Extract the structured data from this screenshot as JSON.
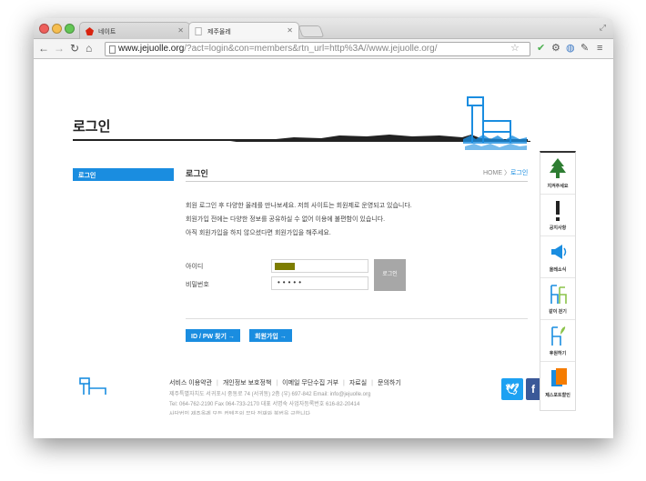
{
  "browser": {
    "tabs": [
      {
        "label": "네이트",
        "active": false
      },
      {
        "label": "제주올레",
        "active": true
      }
    ],
    "url_host": "www.jejuolle.org",
    "url_path": "/?act=login&con=members&rtn_url=http%3A//www.jejuolle.org/",
    "accent": "#1a8de0"
  },
  "page": {
    "heading": "로그인",
    "sidebar": {
      "items": [
        {
          "label": "로그인",
          "active": true
        }
      ]
    },
    "content_title": "로그인",
    "breadcrumb": {
      "home": "HOME",
      "separator": " 〉",
      "current": "로그인"
    },
    "intro": [
      "회원 로그인 후 다양한 올레를 만나보세요. 저희 사이트는 회원제로 운영되고 있습니다.",
      "회원가입 전에는 다양한 정보를 공유하실 수 없어 이용에 불편함이 있습니다.",
      "아직 회원가입을 하지 않으셨다면 회원가입을 해주세요."
    ],
    "form": {
      "id_label": "아이디",
      "pw_label": "비밀번호",
      "pw_value": "•••••",
      "login_button": "로그인"
    },
    "buttons": {
      "find": "ID / PW 찾기 →",
      "join": "회원가입 →"
    }
  },
  "footer": {
    "links": [
      "서비스 이용약관",
      "개인정보 보호정책",
      "이메일 무단수집 거부",
      "자료실",
      "문의하기"
    ],
    "address": "제주특별자치도 서귀포시 중동로 74 (서귀동) 2층 (우) 697-842   Email: info@jejuolle.org",
    "contact": "Tel: 064-762-2190   Fax 064-733-2170   대표 서명숙   사업자등록번호 616-82-20414",
    "copyright": "사단법인 제주올레 모든 컨텐츠의 무단 전재와 불법을 금합니다."
  },
  "quick_menu": [
    {
      "label": "지켜주세요",
      "icon": "tree-icon"
    },
    {
      "label": "공지사항",
      "icon": "exclamation-icon"
    },
    {
      "label": "올레소식",
      "icon": "megaphone-icon"
    },
    {
      "label": "같이 걷기",
      "icon": "chairs-icon"
    },
    {
      "label": "후원하기",
      "icon": "chair-leaf-icon"
    },
    {
      "label": "제스포트할인",
      "icon": "passport-icon"
    }
  ]
}
